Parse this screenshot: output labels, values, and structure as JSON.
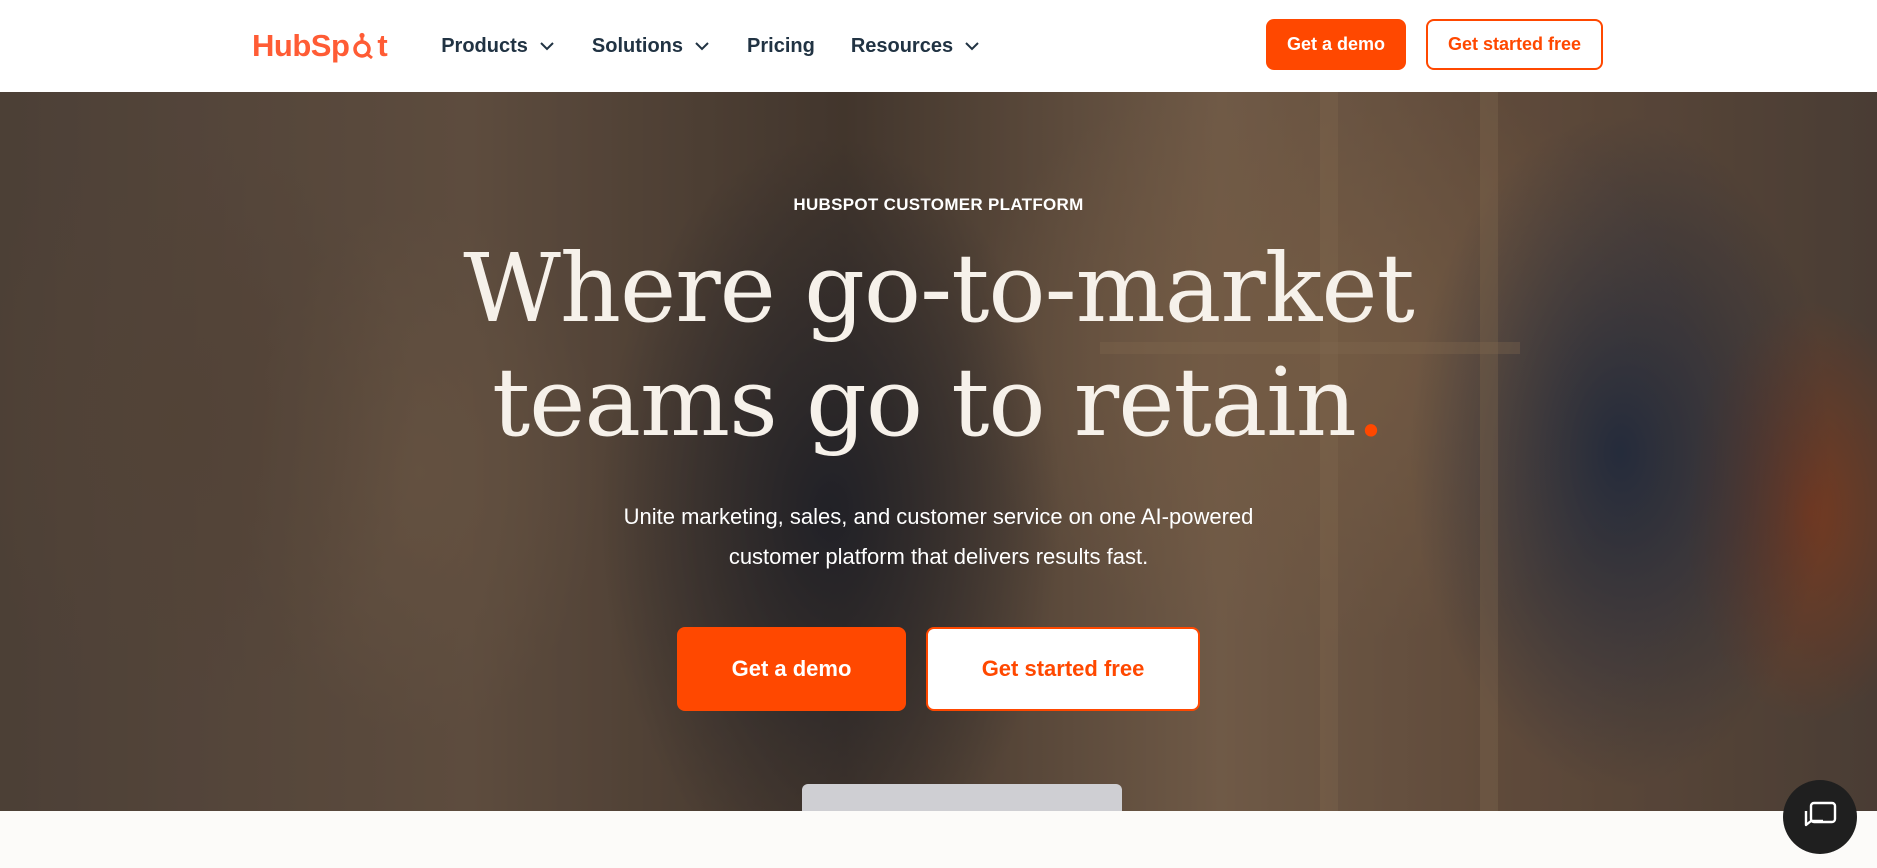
{
  "header": {
    "logo_text_left": "Hub",
    "logo_text_mid": "Sp",
    "logo_text_right": "t",
    "logo_icon": "sprocket-icon",
    "nav": [
      {
        "label": "Products",
        "has_dropdown": true
      },
      {
        "label": "Solutions",
        "has_dropdown": true
      },
      {
        "label": "Pricing",
        "has_dropdown": false
      },
      {
        "label": "Resources",
        "has_dropdown": true
      }
    ],
    "demo_label": "Get a demo",
    "free_label": "Get started free"
  },
  "hero": {
    "eyebrow": "HUBSPOT CUSTOMER PLATFORM",
    "headline_line1": "Where go-to-market",
    "headline_line2": "teams go to retain",
    "headline_dot": ".",
    "subhead_line1": "Unite marketing, sales, and customer service on one AI-powered",
    "subhead_line2": "customer platform that delivers results fast.",
    "demo_label": "Get a demo",
    "free_label": "Get started free"
  },
  "chat": {
    "icon": "chat-icon"
  },
  "colors": {
    "accent": "#ff4800",
    "logo": "#ff5c35",
    "nav_text": "#213343",
    "chat_bg": "#1f1f1f"
  }
}
